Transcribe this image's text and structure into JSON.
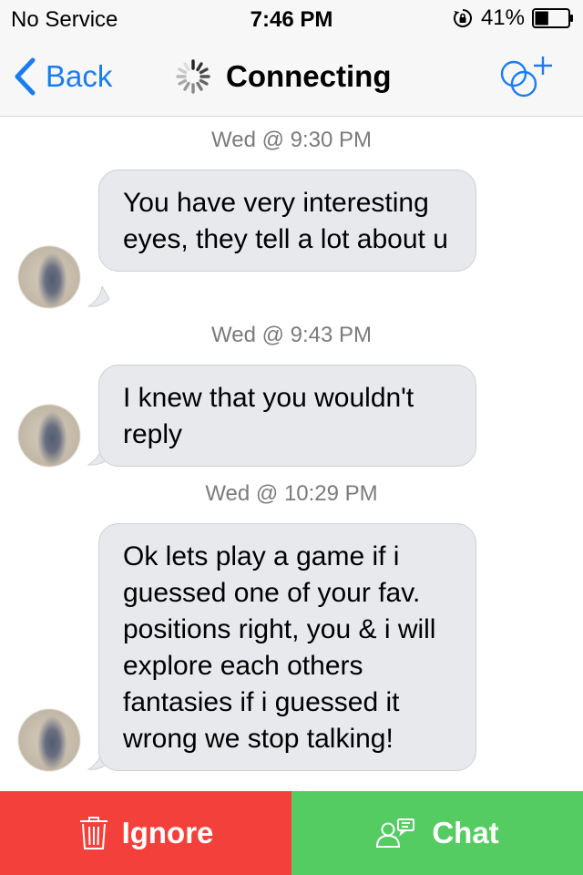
{
  "status_bar": {
    "carrier": "No Service",
    "time": "7:46 PM",
    "battery": "41%",
    "battery_level": 0.41
  },
  "nav": {
    "back_label": "Back",
    "title": "Connecting",
    "back_icon": "chevron-left-icon",
    "spinner_icon": "activity-spinner-icon",
    "action_icon": "add-friend-icon"
  },
  "messages": [
    {
      "timestamp": "Wed @ 9:30 PM",
      "text": "You have very interesting eyes, they tell a lot about u"
    },
    {
      "timestamp": "Wed @ 9:43 PM",
      "text": "I knew that you wouldn't reply"
    },
    {
      "timestamp": "Wed @ 10:29 PM",
      "text": "Ok lets play a game if i guessed one of your fav. positions right, you & i will explore each others fantasies if i guessed it wrong we stop talking!"
    }
  ],
  "actions": {
    "ignore_label": "Ignore",
    "chat_label": "Chat",
    "ignore_icon": "trash-icon",
    "chat_icon": "person-chat-icon"
  },
  "colors": {
    "accent": "#1a7cf5",
    "ignore": "#f4403a",
    "chat": "#55cc62",
    "bubble": "#e8e9ec"
  }
}
